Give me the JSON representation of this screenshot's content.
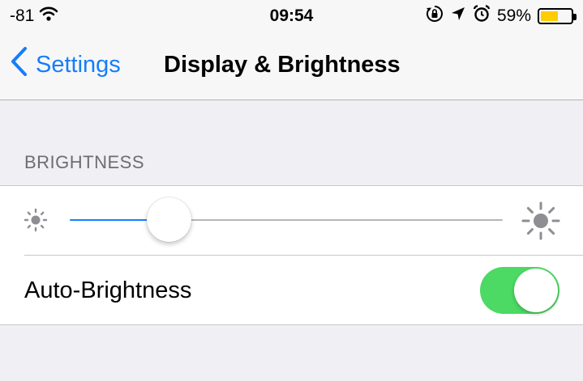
{
  "status_bar": {
    "signal": "-81",
    "time": "09:54",
    "battery_percent": "59%",
    "battery_level": 0.59,
    "icons": [
      "wifi-icon",
      "orientation-lock-icon",
      "location-icon",
      "alarm-icon",
      "battery-icon"
    ]
  },
  "nav": {
    "back_label": "Settings",
    "title": "Display & Brightness"
  },
  "brightness": {
    "section_header": "BRIGHTNESS",
    "slider_value": 0.23,
    "auto_label": "Auto-Brightness",
    "auto_enabled": true
  },
  "colors": {
    "accent": "#157efb",
    "toggle_on": "#4cd964",
    "battery_fill": "#ffcc00",
    "background": "#efeff4"
  }
}
